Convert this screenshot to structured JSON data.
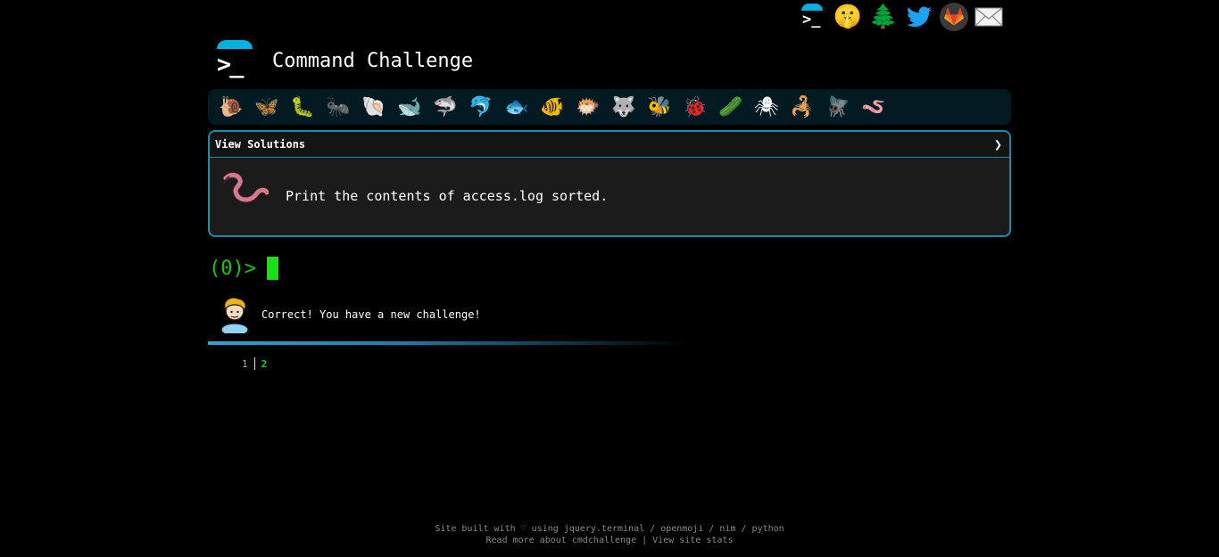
{
  "header": {
    "title": "Command Challenge",
    "logo_prompt": ">_"
  },
  "top_links": [
    {
      "name": "cmdchallenge-icon"
    },
    {
      "name": "shushing-face-icon"
    },
    {
      "name": "tree-icon"
    },
    {
      "name": "twitter-icon"
    },
    {
      "name": "gitlab-icon"
    },
    {
      "name": "mail-icon"
    }
  ],
  "animals": [
    {
      "name": "snail-icon",
      "glyph": "🐌"
    },
    {
      "name": "butterfly-icon",
      "glyph": "🦋"
    },
    {
      "name": "caterpillar-icon",
      "glyph": "🐛"
    },
    {
      "name": "ant-icon",
      "glyph": "🐜"
    },
    {
      "name": "shell-icon",
      "glyph": "🐚"
    },
    {
      "name": "whale-icon",
      "glyph": "🐋"
    },
    {
      "name": "shark-icon",
      "glyph": "🦈"
    },
    {
      "name": "dolphin-icon",
      "glyph": "🐬"
    },
    {
      "name": "fish-icon",
      "glyph": "🐟"
    },
    {
      "name": "tropical-fish-icon",
      "glyph": "🐠"
    },
    {
      "name": "blowfish-icon",
      "glyph": "🐡"
    },
    {
      "name": "wolf-icon",
      "glyph": "🐺"
    },
    {
      "name": "bee-icon",
      "glyph": "🐝"
    },
    {
      "name": "ladybug-icon",
      "glyph": "🐞"
    },
    {
      "name": "cucumber-icon",
      "glyph": "🥒"
    },
    {
      "name": "spider-icon",
      "glyph": "🕷"
    },
    {
      "name": "scorpion-icon",
      "glyph": "🦂"
    },
    {
      "name": "fly-icon",
      "glyph": "🪰"
    },
    {
      "name": "worm-icon",
      "glyph": "🪱"
    }
  ],
  "panel": {
    "header_label": "View Solutions",
    "chevron": "❯",
    "challenge_text": "Print the contents of access.log sorted."
  },
  "terminal": {
    "prompt": "(0)>",
    "response": "Correct! You have a new challenge!",
    "line_numbers": [
      "1",
      "2"
    ]
  },
  "footer": {
    "line1_prefix": "Site built with ♡ using ",
    "link_jquery": "jquery.terminal",
    "sep": " / ",
    "link_openmoji": "openmoji",
    "link_nim": "nim",
    "link_python": "python",
    "link_read_more": "Read more about cmdchallenge",
    "pipe": " | ",
    "link_stats": "View site stats"
  },
  "colors": {
    "accent": "#00b0e0",
    "panel_border": "#1f8aa8",
    "prompt_green": "#17c617",
    "cursor_green": "#16e016"
  }
}
